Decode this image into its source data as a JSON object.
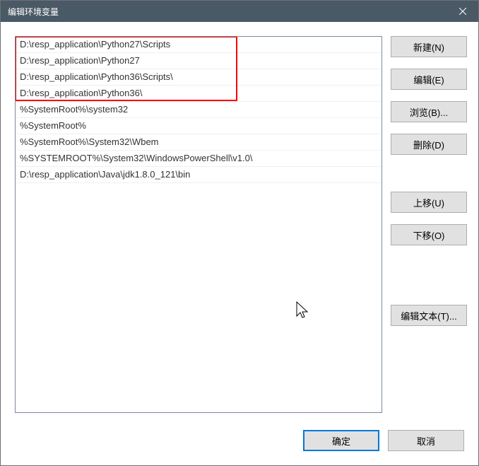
{
  "titlebar": {
    "title": "编辑环境变量"
  },
  "list": {
    "items": [
      "D:\\resp_application\\Python27\\Scripts",
      "D:\\resp_application\\Python27",
      "D:\\resp_application\\Python36\\Scripts\\",
      "D:\\resp_application\\Python36\\",
      "%SystemRoot%\\system32",
      "%SystemRoot%",
      "%SystemRoot%\\System32\\Wbem",
      "%SYSTEMROOT%\\System32\\WindowsPowerShell\\v1.0\\",
      "D:\\resp_application\\Java\\jdk1.8.0_121\\bin"
    ]
  },
  "buttons": {
    "new": "新建(N)",
    "edit": "编辑(E)",
    "browse": "浏览(B)...",
    "delete": "删除(D)",
    "moveup": "上移(U)",
    "movedown": "下移(O)",
    "edittext": "编辑文本(T)..."
  },
  "footer": {
    "ok": "确定",
    "cancel": "取消"
  }
}
